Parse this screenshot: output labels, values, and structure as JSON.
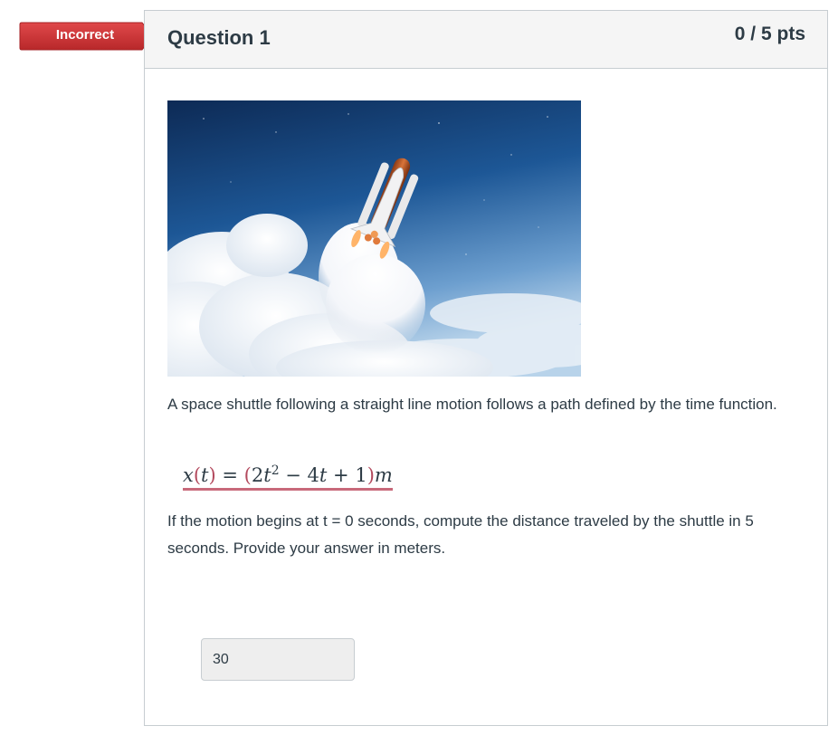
{
  "flag": {
    "label": "Incorrect",
    "color": "#d0393a"
  },
  "question": {
    "title": "Question 1",
    "points": "0 / 5 pts",
    "paragraph1": "A space shuttle following a straight line motion follows a path defined by the time function.",
    "formula": {
      "lhs_var": "x",
      "lhs_arg": "t",
      "rhs_open": "(2",
      "rhs_t1": "t",
      "rhs_exp": "2",
      "rhs_rest": " − 4",
      "rhs_t2": "t",
      "rhs_tail": " + 1",
      "rhs_close": ")",
      "unit": "m"
    },
    "paragraph2": "If the motion begins at t = 0 seconds, compute the distance traveled by the shuttle in 5 seconds. Provide your answer in meters.",
    "answer_value": "30"
  },
  "image": {
    "icon": "space-shuttle-launch-image"
  }
}
